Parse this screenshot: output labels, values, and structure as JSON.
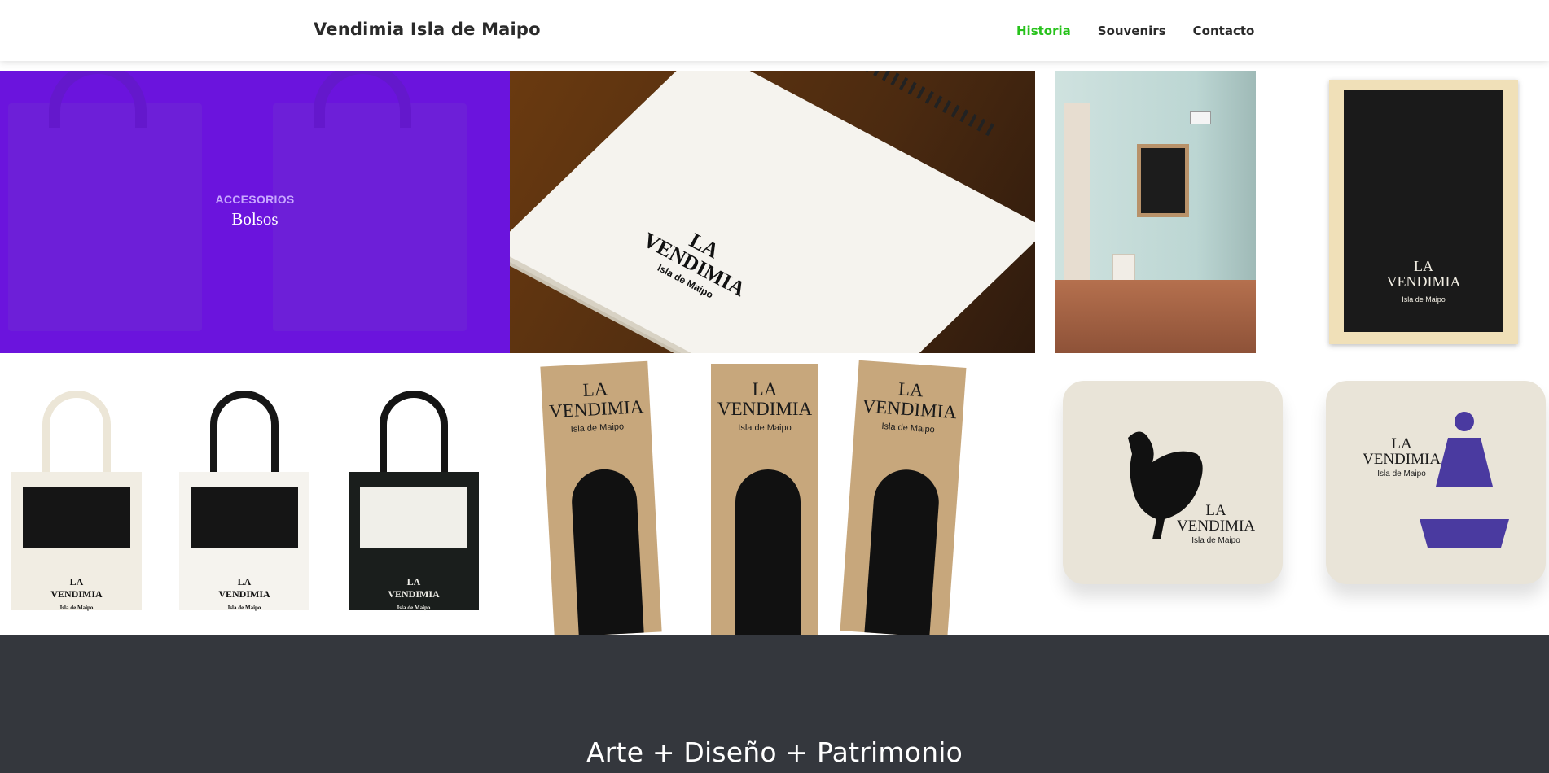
{
  "header": {
    "brand": "Vendimia Isla de Maipo",
    "nav": [
      {
        "label": "Historia",
        "active": true
      },
      {
        "label": "Souvenirs",
        "active": false
      },
      {
        "label": "Contacto",
        "active": false
      }
    ],
    "active_color": "#27c21b"
  },
  "gallery": {
    "featured": {
      "category": "ACCESORIOS",
      "title": "Bolsos",
      "overlay_color": "#6b14dd"
    },
    "product_text": {
      "brand_line_1": "LA",
      "brand_line_2": "VENDIMIA",
      "brand_sub": "Isla de Maipo"
    }
  },
  "footer": {
    "heading": "Arte + Diseño + Patrimonio",
    "background": "#34373d"
  }
}
